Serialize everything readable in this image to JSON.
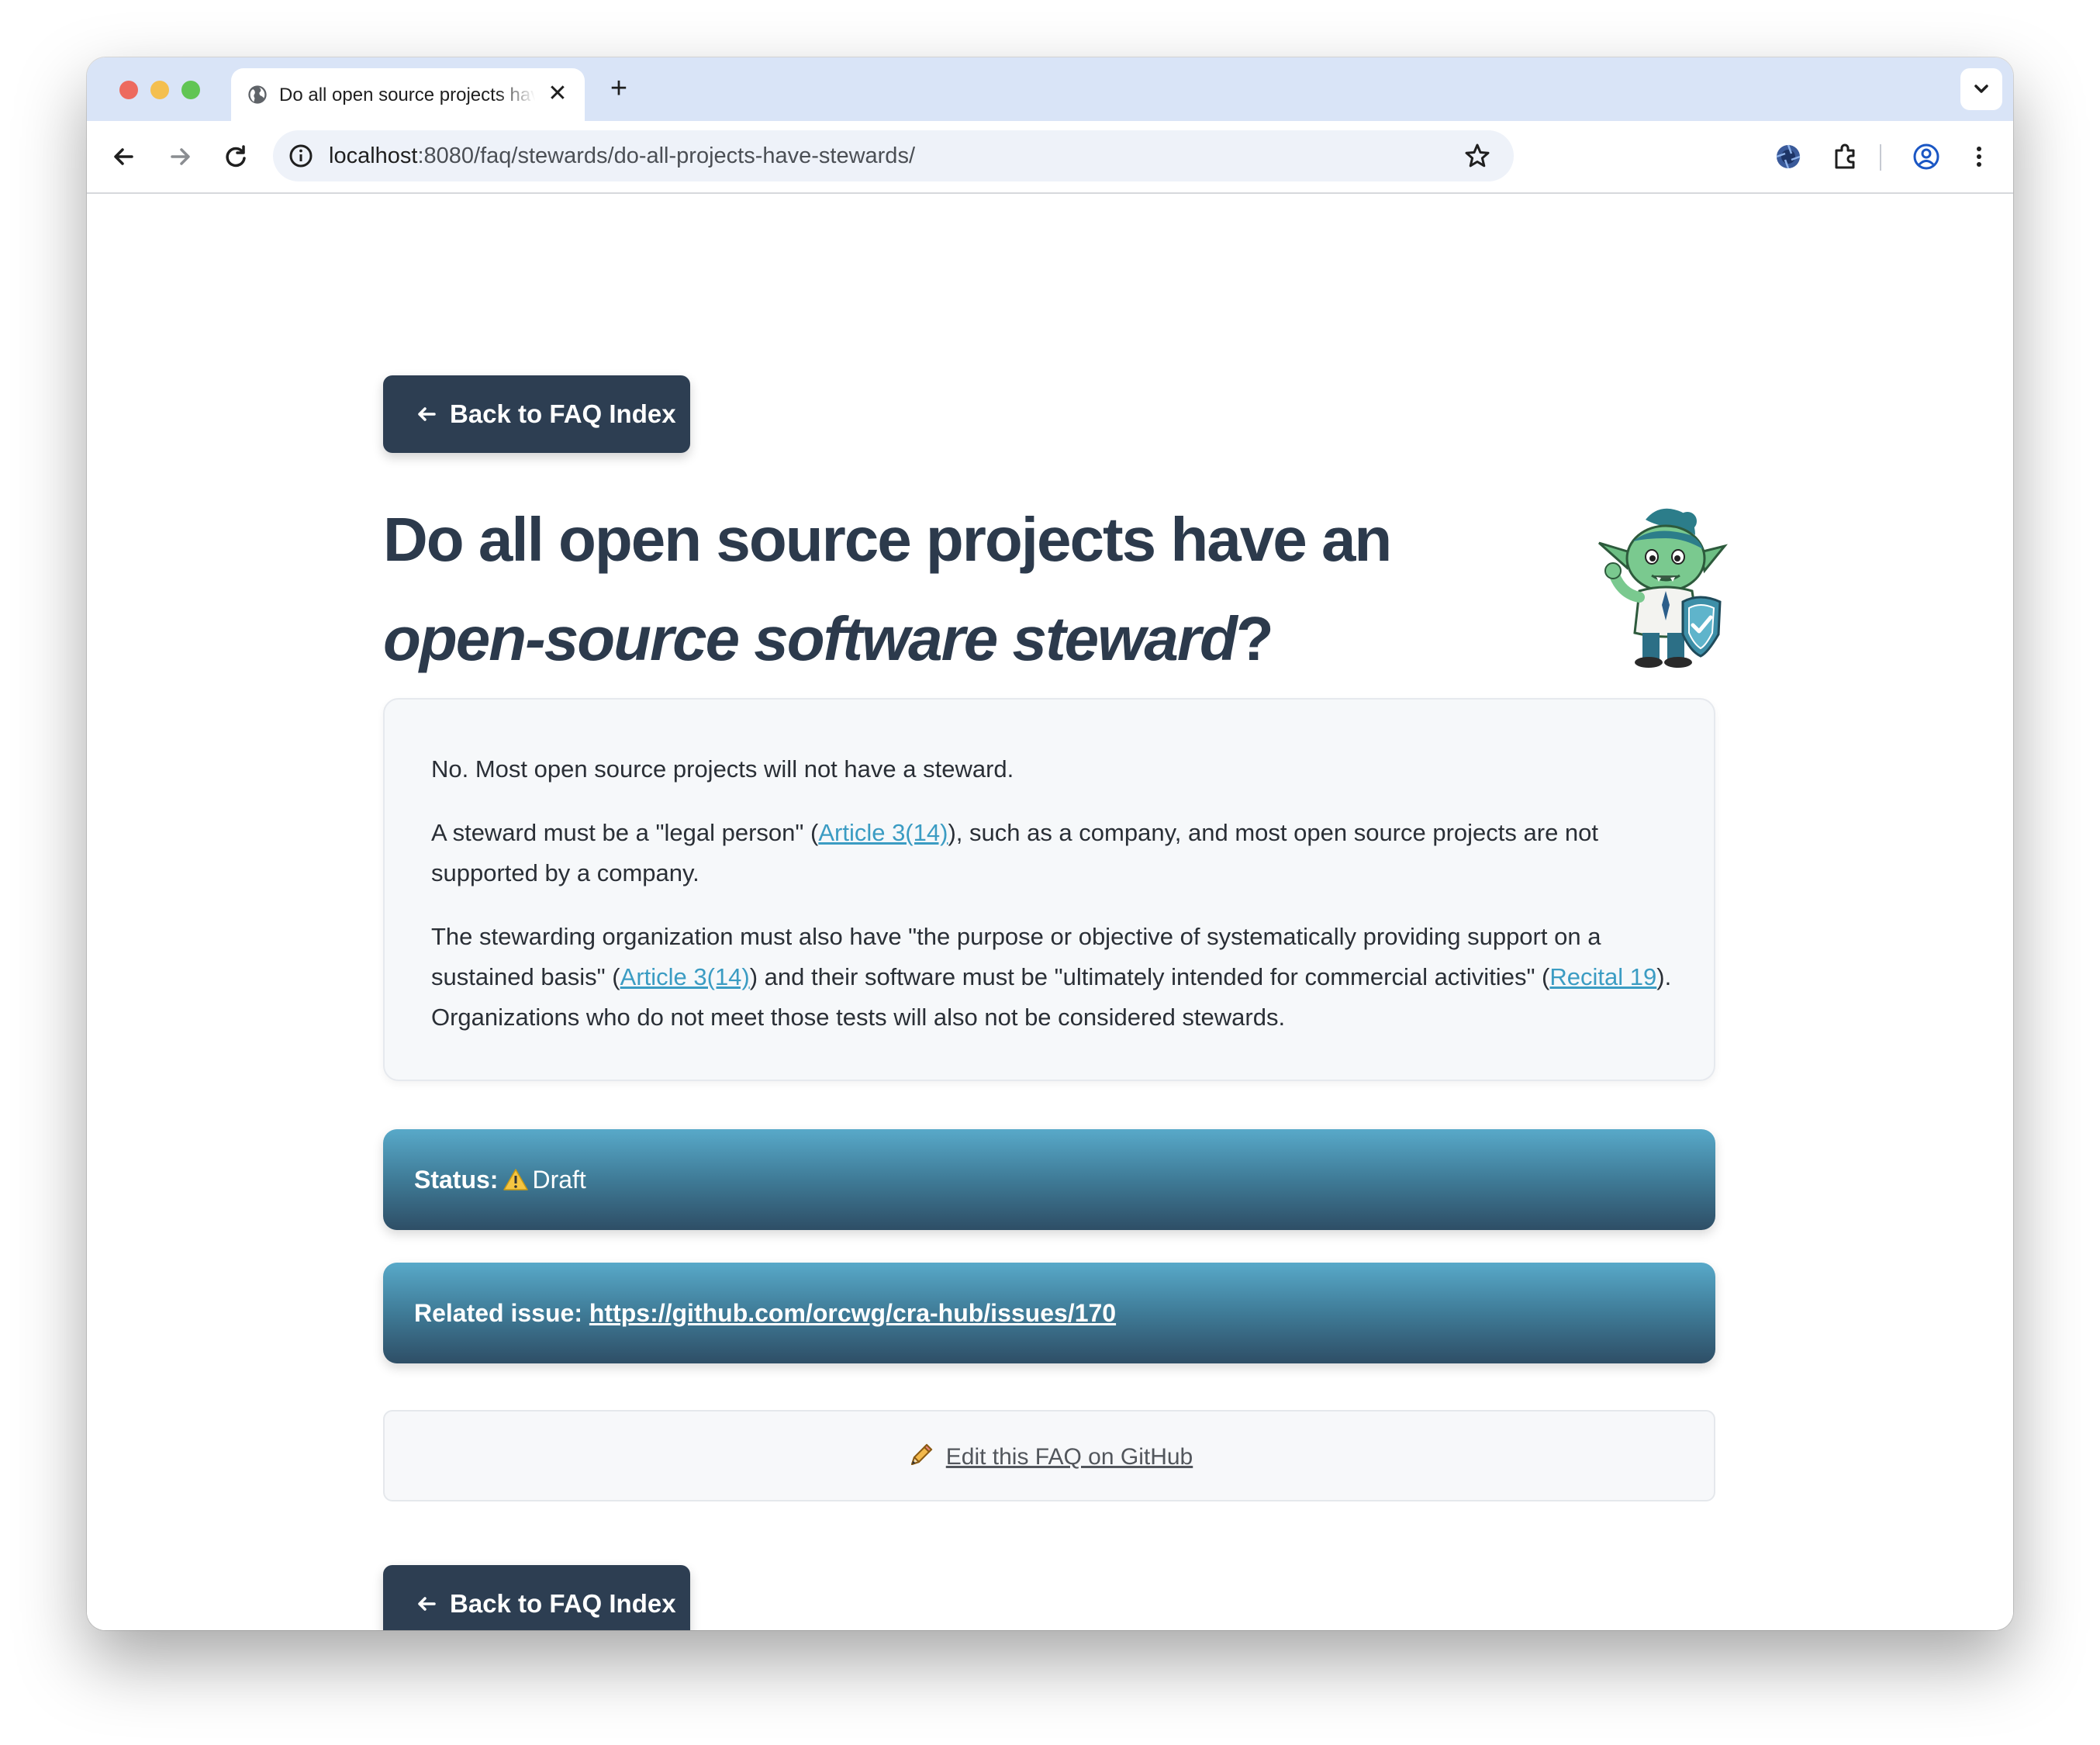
{
  "browser": {
    "tab_title": "Do all open source projects have an open-source software steward?",
    "url_host": "localhost",
    "url_path": ":8080/faq/stewards/do-all-projects-have-stewards/"
  },
  "page": {
    "back_label": "Back to FAQ Index",
    "title_part1": "Do all open source projects have an ",
    "title_em": "open-source software steward",
    "title_end": "?",
    "answer": {
      "p1": "No. Most open source projects will not have a steward.",
      "p2_a": "A steward must be a \"legal person\" (",
      "p2_link": "Article 3(14)",
      "p2_b": "), such as a company, and most open source projects are not supported by a company.",
      "p3_a": "The stewarding organization must also have \"the purpose or objective of systematically providing support on a sustained basis\" (",
      "p3_link1": "Article 3(14)",
      "p3_b": ") and their software must be \"ultimately intended for commercial activities\" (",
      "p3_link2": "Recital 19",
      "p3_c": "). Organizations who do not meet those tests will also not be considered stewards."
    },
    "status": {
      "label": "Status:",
      "value": "Draft",
      "icon": "warning-icon"
    },
    "related": {
      "label": "Related issue:",
      "link": "https://github.com/orcwg/cra-hub/issues/170"
    },
    "edit": {
      "icon": "pencil-icon",
      "label": "Edit this FAQ on GitHub"
    }
  },
  "colors": {
    "button_bg": "#2d3e52",
    "title": "#2c3a4c",
    "link": "#3b9cc3",
    "banner_top": "#58a9c9",
    "banner_bottom": "#2e4e66"
  }
}
